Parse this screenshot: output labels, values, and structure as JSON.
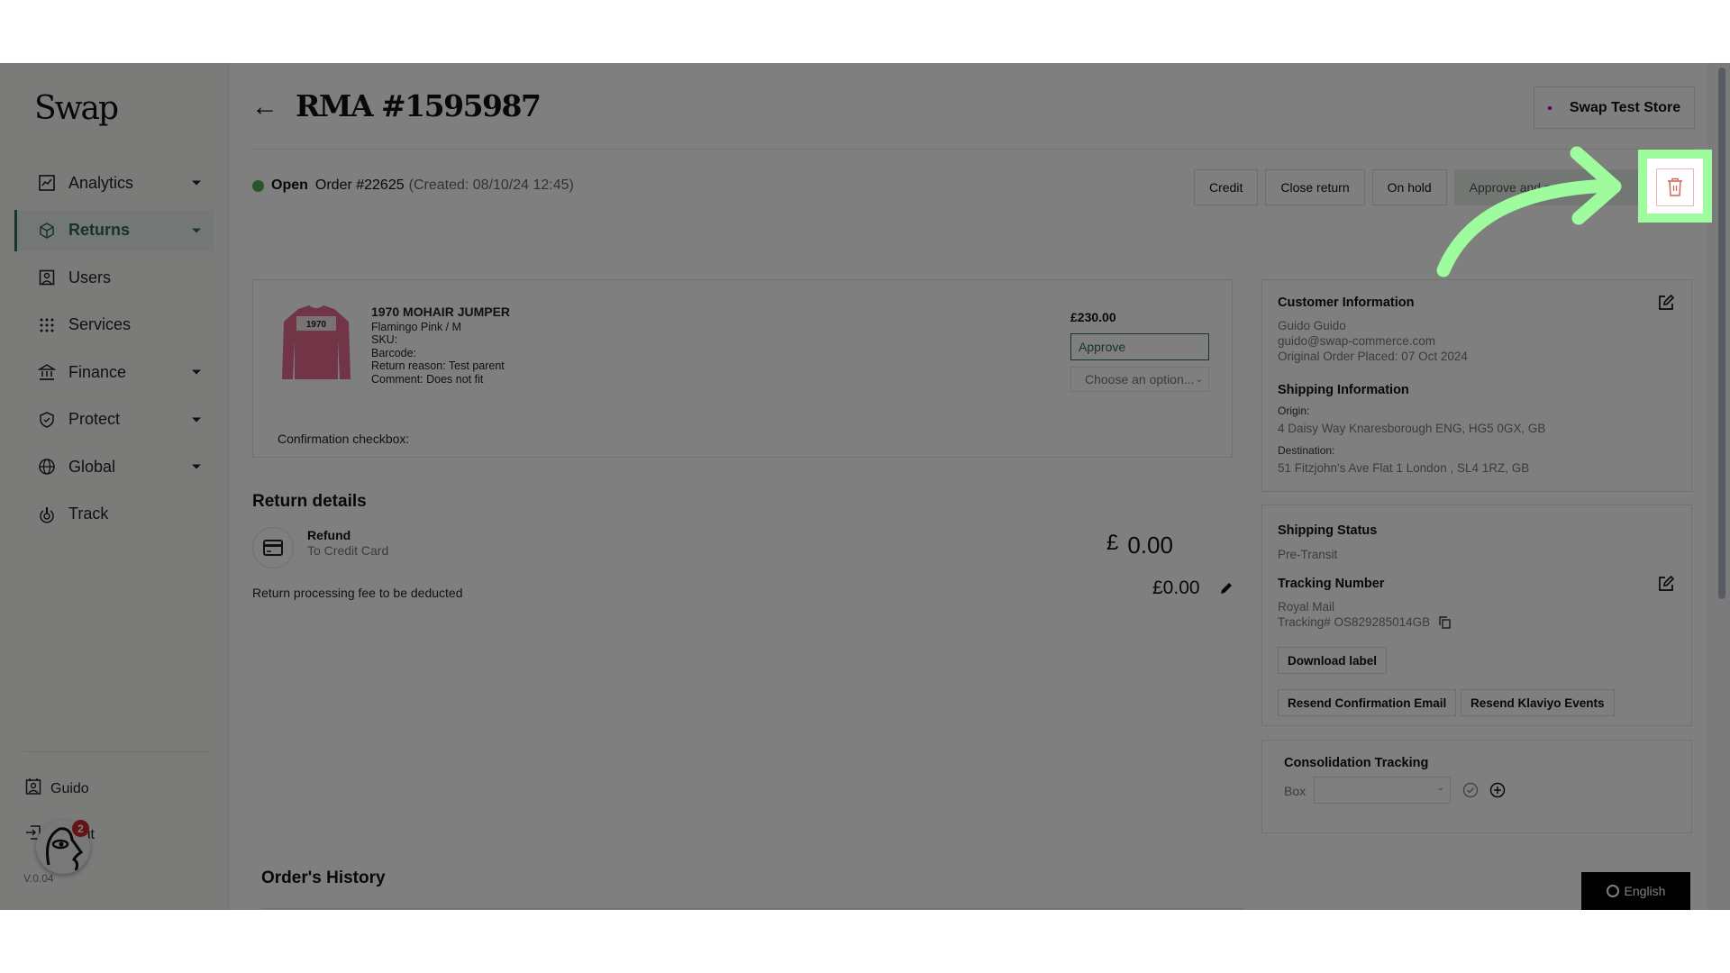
{
  "app": {
    "logo": "Swap",
    "version": "V.0.04",
    "notification_count": "2"
  },
  "sidebar": {
    "items": [
      {
        "label": "Analytics",
        "icon": "chart-icon",
        "has_caret": true,
        "active": false
      },
      {
        "label": "Returns",
        "icon": "box-icon",
        "has_caret": true,
        "active": true
      },
      {
        "label": "Users",
        "icon": "user-icon",
        "has_caret": false,
        "active": false
      },
      {
        "label": "Services",
        "icon": "grid-icon",
        "has_caret": false,
        "active": false
      },
      {
        "label": "Finance",
        "icon": "bank-icon",
        "has_caret": true,
        "active": false
      },
      {
        "label": "Protect",
        "icon": "shield-icon",
        "has_caret": true,
        "active": false
      },
      {
        "label": "Global",
        "icon": "globe-icon",
        "has_caret": true,
        "active": false
      },
      {
        "label": "Track",
        "icon": "track-icon",
        "has_caret": false,
        "active": false
      }
    ],
    "user_label": "Guido",
    "logout_label": "Logout"
  },
  "header": {
    "title": "RMA #1595987",
    "store_label": "Swap Test Store"
  },
  "status": {
    "state": "Open",
    "order": "Order #22625",
    "created": "(Created: 08/10/24 12:45)",
    "state_color": "#4caf50"
  },
  "actions": {
    "credit": "Credit",
    "close_return": "Close return",
    "on_hold": "On hold",
    "approve_process": "Approve and process",
    "delete_icon": "trash-icon"
  },
  "product": {
    "name": "1970 MOHAIR JUMPER",
    "variant": "Flamingo Pink / M",
    "sku": "SKU:",
    "barcode": "Barcode:",
    "return_reason": "Return reason: Test parent",
    "comment": "Comment: Does not fit",
    "price": "£230.00",
    "decision": "Approve",
    "option_placeholder": "Choose an option...",
    "confirmation_label": "Confirmation checkbox:",
    "image_text": "1970"
  },
  "return_details": {
    "title": "Return details",
    "method": "Refund",
    "method_sub": "To Credit Card",
    "currency": "£",
    "amount": "0.00",
    "fee_label": "Return processing fee to be deducted",
    "fee_amount": "£0.00"
  },
  "customer": {
    "title": "Customer Information",
    "name": "Guido Guido",
    "email": "guido@swap-commerce.com",
    "order_placed": "Original Order Placed: 07 Oct 2024"
  },
  "shipping": {
    "title": "Shipping Information",
    "origin_label": "Origin:",
    "origin": "4 Daisy Way  Knaresborough ENG, HG5 0GX, GB",
    "destination_label": "Destination:",
    "destination": "51 Fitzjohn's Ave Flat 1 London , SL4 1RZ, GB"
  },
  "shipping_status": {
    "title": "Shipping Status",
    "status": "Pre-Transit",
    "tracking_title": "Tracking Number",
    "carrier": "Royal Mail",
    "tracking": "Tracking# OS829285014GB",
    "download_label": "Download label",
    "resend_email": "Resend Confirmation Email",
    "resend_klaviyo": "Resend Klaviyo Events"
  },
  "consolidation": {
    "title": "Consolidation Tracking",
    "box_label": "Box",
    "box_value": ""
  },
  "order_history": {
    "title": "Order's History"
  },
  "language": {
    "label": "English"
  },
  "annotation": {
    "highlight_color": "#9efc9e"
  }
}
